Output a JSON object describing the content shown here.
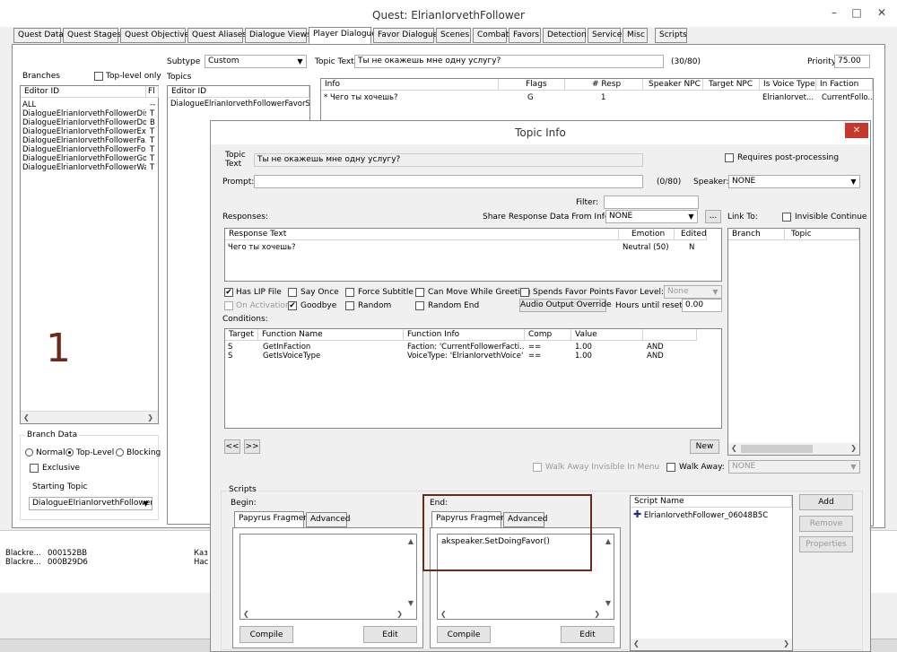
{
  "main_window": {
    "title": "Quest: ElrianIorvethFollower",
    "tabs": [
      {
        "label": "Quest Data"
      },
      {
        "label": "Quest Stages"
      },
      {
        "label": "Quest Objectives"
      },
      {
        "label": "Quest Aliases"
      },
      {
        "label": "Dialogue Views"
      },
      {
        "label": "Player Dialogue"
      },
      {
        "label": "Favor Dialogue"
      },
      {
        "label": "Scenes"
      },
      {
        "label": "Combat"
      },
      {
        "label": "Favors"
      },
      {
        "label": "Detection"
      },
      {
        "label": "Service"
      },
      {
        "label": "Misc"
      },
      {
        "label": "Scripts"
      }
    ],
    "active_tab": "Player Dialogue",
    "branches_label": "Branches",
    "top_level_only_label": "Top-level only",
    "branch_columns": [
      "Editor ID",
      "Fl"
    ],
    "branches": [
      {
        "id": "ALL",
        "flag": "--"
      },
      {
        "id": "DialogueElrianIorvethFollowerDis...",
        "flag": "T"
      },
      {
        "id": "DialogueElrianIorvethFollowerDoi...",
        "flag": "B"
      },
      {
        "id": "DialogueElrianIorvethFollowerEx...",
        "flag": "T"
      },
      {
        "id": "DialogueElrianIorvethFollowerFa...",
        "flag": "T"
      },
      {
        "id": "DialogueElrianIorvethFollowerFoll...",
        "flag": "T"
      },
      {
        "id": "DialogueElrianIorvethFollowerGo",
        "flag": "T"
      },
      {
        "id": "DialogueElrianIorvethFollowerWait",
        "flag": "T"
      }
    ],
    "big_number": "1",
    "branch_data": {
      "title": "Branch Data",
      "normal": "Normal",
      "top_level": "Top-Level",
      "blocking": "Blocking",
      "exclusive": "Exclusive",
      "starting_topic_label": "Starting Topic",
      "starting_topic": "DialogueElrianIorvethFollowerF"
    },
    "subtype_label": "Subtype",
    "subtype": "Custom",
    "topics_label": "Topics",
    "topic_columns": [
      "Editor ID"
    ],
    "topics": [
      "DialogueElrianIorvethFollowerFavorState"
    ],
    "topic_text_label": "Topic Text",
    "topic_text": "Ты не окажешь мне одну услугу?",
    "topic_text_count": "(30/80)",
    "priority_label": "Priority",
    "priority": "75.00",
    "info_columns": [
      "Info",
      "Flags",
      "# Resp",
      "Speaker NPC",
      "Target NPC",
      "Is Voice Type",
      "In Faction"
    ],
    "info_rows": [
      {
        "info": "* Чего ты хочешь?",
        "flags": "G",
        "resp": "1",
        "speaker": "",
        "target": "",
        "voice": "ElrianIorvet...",
        "faction": "CurrentFollo..."
      }
    ],
    "bottom_rows": [
      {
        "a": "Blackre...",
        "b": "000152BB",
        "c": "Каз"
      },
      {
        "a": "Blackre...",
        "b": "000B29D6",
        "c": "Нас"
      }
    ]
  },
  "topic_info": {
    "title": "Topic Info",
    "topic_text_label": "Topic Text",
    "topic_text": "Ты не окажешь мне одну услугу?",
    "requires_post_label": "Requires post-processing",
    "prompt_label": "Prompt:",
    "prompt_value": "",
    "prompt_count": "(0/80)",
    "speaker_label": "Speaker:",
    "speaker": "NONE",
    "filter_label": "Filter:",
    "responses_label": "Responses:",
    "share_label": "Share Response Data From Info:",
    "share_value": "NONE",
    "share_btn": "...",
    "link_to_label": "Link To:",
    "invisible_continue_label": "Invisible Continue",
    "response_columns": [
      "Response Text",
      "Emotion",
      "Edited"
    ],
    "responses": [
      {
        "text": "Чего ты хочешь?",
        "emotion": "Neutral (50)",
        "edited": "N"
      }
    ],
    "link_columns": [
      "Branch",
      "Topic"
    ],
    "flags": {
      "has_lip": "Has LIP File",
      "say_once": "Say Once",
      "force_subtitle": "Force Subtitle",
      "can_move": "Can Move While Greeting",
      "spends_favor": "Spends Favor Points",
      "on_activation": "On Activation",
      "goodbye": "Goodbye",
      "random": "Random",
      "random_end": "Random End"
    },
    "favor_level_label": "Favor Level:",
    "favor_level": "None",
    "audio_override": "Audio Output Override",
    "hours_label": "Hours until reset:",
    "hours": "0.00",
    "conditions_label": "Conditions:",
    "condition_columns": [
      "Target",
      "Function Name",
      "Function Info",
      "Comp",
      "Value",
      ""
    ],
    "conditions": [
      {
        "target": "S",
        "func": "GetInFaction",
        "info": "Faction: 'CurrentFollowerFacti...",
        "comp": "==",
        "value": "1.00",
        "op": "AND"
      },
      {
        "target": "S",
        "func": "GetIsVoiceType",
        "info": "VoiceType: 'ElrianIorvethVoice'",
        "comp": "==",
        "value": "1.00",
        "op": "AND"
      }
    ],
    "prev_btn": "<<",
    "next_btn": ">>",
    "new_btn": "New",
    "walk_away_invisible": "Walk Away Invisible In Menu",
    "walk_away_label": "Walk Away:",
    "walk_away_value": "NONE",
    "scripts_label": "Scripts",
    "begin_label": "Begin:",
    "end_label": "End:",
    "papyrus_tab": "Papyrus Fragment",
    "advanced_tab": "Advanced",
    "begin_code": "",
    "end_code": "akspeaker.SetDoingFavor()",
    "compile_btn": "Compile",
    "edit_btn": "Edit",
    "script_name_col": "Script Name",
    "scripts": [
      "ElrianIorvethFollower_06048B5C"
    ],
    "add_btn": "Add",
    "remove_btn": "Remove",
    "properties_btn": "Properties",
    "highlight_color": "#6b2a1a",
    "close_color": "#c7372c"
  }
}
